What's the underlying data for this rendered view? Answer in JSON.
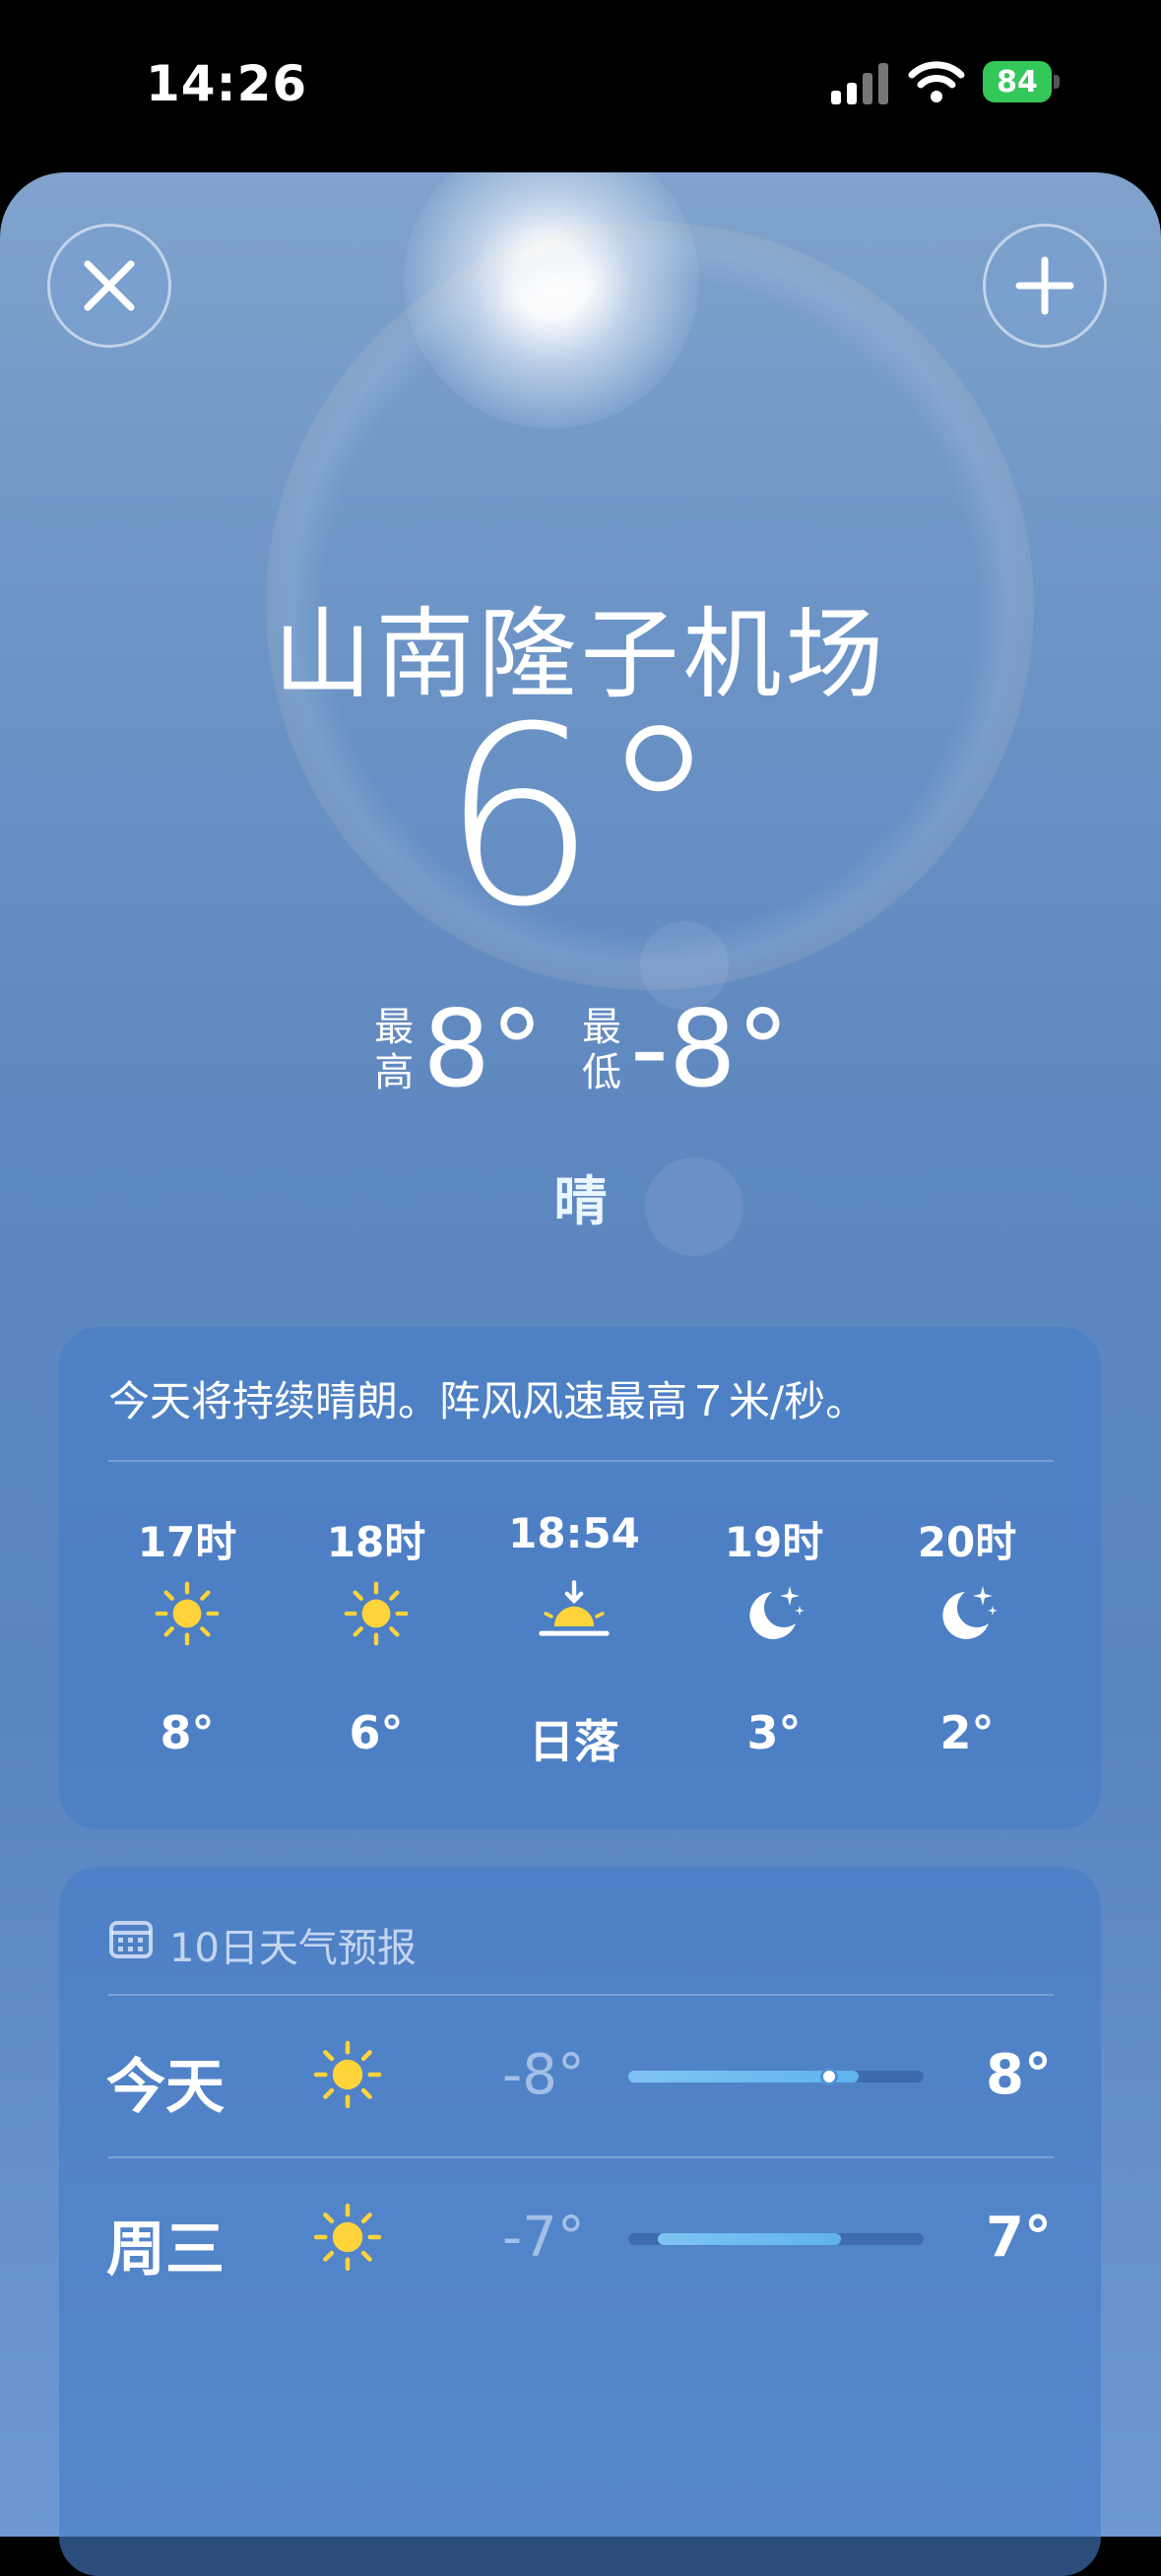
{
  "status_bar": {
    "time": "14:26",
    "battery": "84"
  },
  "weather": {
    "location": "山南隆子机场",
    "temperature": "6°",
    "high_label": "最\n高",
    "high": "8°",
    "low_label": "最\n低",
    "low": "-8°",
    "condition": "晴"
  },
  "hourly": {
    "summary": "今天将持续晴朗。阵风风速最高７米/秒。",
    "items": [
      {
        "label": "17时",
        "icon": "sun-icon",
        "value": "8°"
      },
      {
        "label": "18时",
        "icon": "sun-icon",
        "value": "6°"
      },
      {
        "label": "18:54",
        "icon": "sunset-icon",
        "value": "日落"
      },
      {
        "label": "19时",
        "icon": "moon-stars-icon",
        "value": "3°"
      },
      {
        "label": "20时",
        "icon": "moon-stars-icon",
        "value": "2°"
      }
    ]
  },
  "forecast": {
    "title": "10日天气预报",
    "days": [
      {
        "day": "今天",
        "icon": "sun-icon",
        "low": "-8°",
        "high": "8°",
        "range_start": 0.0,
        "range_end": 0.78,
        "current": 0.68
      },
      {
        "day": "周三",
        "icon": "sun-icon",
        "low": "-7°",
        "high": "7°",
        "range_start": 0.1,
        "range_end": 0.72
      }
    ]
  },
  "colors": {
    "sun": "#ffd43b",
    "moon": "#ffffff",
    "battery": "#34c759",
    "sheet_top": "#7fa3cc",
    "card": "#467dc8"
  }
}
